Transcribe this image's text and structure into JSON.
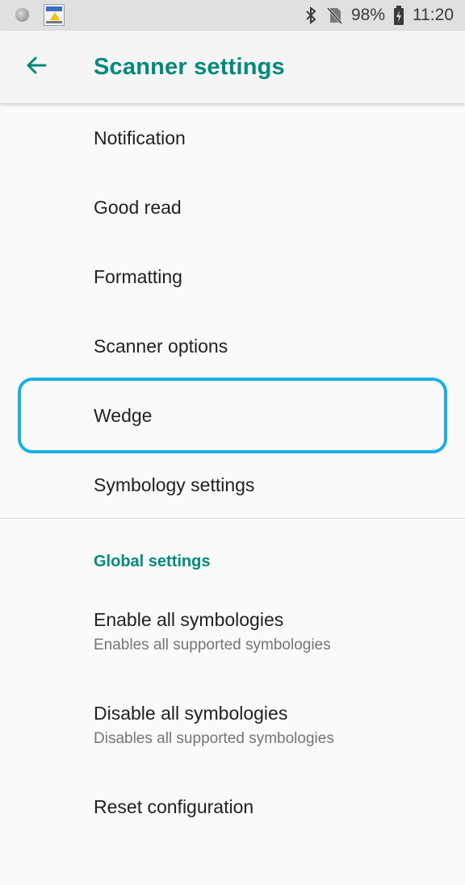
{
  "status_bar": {
    "battery": "98%",
    "time": "11:20"
  },
  "app_bar": {
    "title": "Scanner settings",
    "back_icon": "arrow-back-icon"
  },
  "menu_items": [
    {
      "label": "Notification"
    },
    {
      "label": "Good read"
    },
    {
      "label": "Formatting"
    },
    {
      "label": "Scanner options"
    },
    {
      "label": "Wedge"
    },
    {
      "label": "Symbology settings"
    }
  ],
  "global_settings": {
    "header": "Global settings",
    "items": [
      {
        "title": "Enable all symbologies",
        "summary": "Enables all supported symbologies"
      },
      {
        "title": "Disable all symbologies",
        "summary": "Disables all supported symbologies"
      },
      {
        "title": "Reset configuration",
        "summary": ""
      }
    ]
  },
  "colors": {
    "accent": "#00897b",
    "highlight": "#1aaee4"
  }
}
